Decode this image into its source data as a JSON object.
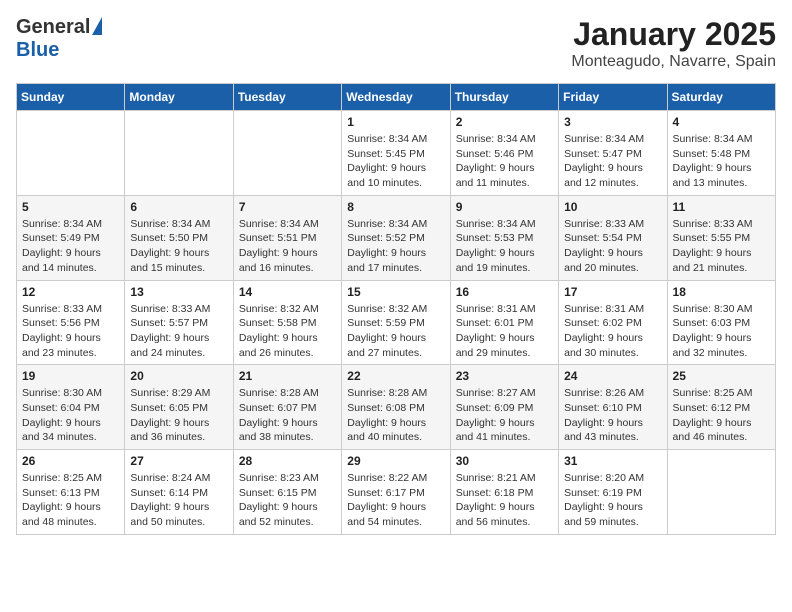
{
  "header": {
    "logo_general": "General",
    "logo_blue": "Blue",
    "month_title": "January 2025",
    "location": "Monteagudo, Navarre, Spain"
  },
  "weekdays": [
    "Sunday",
    "Monday",
    "Tuesday",
    "Wednesday",
    "Thursday",
    "Friday",
    "Saturday"
  ],
  "weeks": [
    [
      {
        "day": "",
        "info": ""
      },
      {
        "day": "",
        "info": ""
      },
      {
        "day": "",
        "info": ""
      },
      {
        "day": "1",
        "info": "Sunrise: 8:34 AM\nSunset: 5:45 PM\nDaylight: 9 hours\nand 10 minutes."
      },
      {
        "day": "2",
        "info": "Sunrise: 8:34 AM\nSunset: 5:46 PM\nDaylight: 9 hours\nand 11 minutes."
      },
      {
        "day": "3",
        "info": "Sunrise: 8:34 AM\nSunset: 5:47 PM\nDaylight: 9 hours\nand 12 minutes."
      },
      {
        "day": "4",
        "info": "Sunrise: 8:34 AM\nSunset: 5:48 PM\nDaylight: 9 hours\nand 13 minutes."
      }
    ],
    [
      {
        "day": "5",
        "info": "Sunrise: 8:34 AM\nSunset: 5:49 PM\nDaylight: 9 hours\nand 14 minutes."
      },
      {
        "day": "6",
        "info": "Sunrise: 8:34 AM\nSunset: 5:50 PM\nDaylight: 9 hours\nand 15 minutes."
      },
      {
        "day": "7",
        "info": "Sunrise: 8:34 AM\nSunset: 5:51 PM\nDaylight: 9 hours\nand 16 minutes."
      },
      {
        "day": "8",
        "info": "Sunrise: 8:34 AM\nSunset: 5:52 PM\nDaylight: 9 hours\nand 17 minutes."
      },
      {
        "day": "9",
        "info": "Sunrise: 8:34 AM\nSunset: 5:53 PM\nDaylight: 9 hours\nand 19 minutes."
      },
      {
        "day": "10",
        "info": "Sunrise: 8:33 AM\nSunset: 5:54 PM\nDaylight: 9 hours\nand 20 minutes."
      },
      {
        "day": "11",
        "info": "Sunrise: 8:33 AM\nSunset: 5:55 PM\nDaylight: 9 hours\nand 21 minutes."
      }
    ],
    [
      {
        "day": "12",
        "info": "Sunrise: 8:33 AM\nSunset: 5:56 PM\nDaylight: 9 hours\nand 23 minutes."
      },
      {
        "day": "13",
        "info": "Sunrise: 8:33 AM\nSunset: 5:57 PM\nDaylight: 9 hours\nand 24 minutes."
      },
      {
        "day": "14",
        "info": "Sunrise: 8:32 AM\nSunset: 5:58 PM\nDaylight: 9 hours\nand 26 minutes."
      },
      {
        "day": "15",
        "info": "Sunrise: 8:32 AM\nSunset: 5:59 PM\nDaylight: 9 hours\nand 27 minutes."
      },
      {
        "day": "16",
        "info": "Sunrise: 8:31 AM\nSunset: 6:01 PM\nDaylight: 9 hours\nand 29 minutes."
      },
      {
        "day": "17",
        "info": "Sunrise: 8:31 AM\nSunset: 6:02 PM\nDaylight: 9 hours\nand 30 minutes."
      },
      {
        "day": "18",
        "info": "Sunrise: 8:30 AM\nSunset: 6:03 PM\nDaylight: 9 hours\nand 32 minutes."
      }
    ],
    [
      {
        "day": "19",
        "info": "Sunrise: 8:30 AM\nSunset: 6:04 PM\nDaylight: 9 hours\nand 34 minutes."
      },
      {
        "day": "20",
        "info": "Sunrise: 8:29 AM\nSunset: 6:05 PM\nDaylight: 9 hours\nand 36 minutes."
      },
      {
        "day": "21",
        "info": "Sunrise: 8:28 AM\nSunset: 6:07 PM\nDaylight: 9 hours\nand 38 minutes."
      },
      {
        "day": "22",
        "info": "Sunrise: 8:28 AM\nSunset: 6:08 PM\nDaylight: 9 hours\nand 40 minutes."
      },
      {
        "day": "23",
        "info": "Sunrise: 8:27 AM\nSunset: 6:09 PM\nDaylight: 9 hours\nand 41 minutes."
      },
      {
        "day": "24",
        "info": "Sunrise: 8:26 AM\nSunset: 6:10 PM\nDaylight: 9 hours\nand 43 minutes."
      },
      {
        "day": "25",
        "info": "Sunrise: 8:25 AM\nSunset: 6:12 PM\nDaylight: 9 hours\nand 46 minutes."
      }
    ],
    [
      {
        "day": "26",
        "info": "Sunrise: 8:25 AM\nSunset: 6:13 PM\nDaylight: 9 hours\nand 48 minutes."
      },
      {
        "day": "27",
        "info": "Sunrise: 8:24 AM\nSunset: 6:14 PM\nDaylight: 9 hours\nand 50 minutes."
      },
      {
        "day": "28",
        "info": "Sunrise: 8:23 AM\nSunset: 6:15 PM\nDaylight: 9 hours\nand 52 minutes."
      },
      {
        "day": "29",
        "info": "Sunrise: 8:22 AM\nSunset: 6:17 PM\nDaylight: 9 hours\nand 54 minutes."
      },
      {
        "day": "30",
        "info": "Sunrise: 8:21 AM\nSunset: 6:18 PM\nDaylight: 9 hours\nand 56 minutes."
      },
      {
        "day": "31",
        "info": "Sunrise: 8:20 AM\nSunset: 6:19 PM\nDaylight: 9 hours\nand 59 minutes."
      },
      {
        "day": "",
        "info": ""
      }
    ]
  ]
}
